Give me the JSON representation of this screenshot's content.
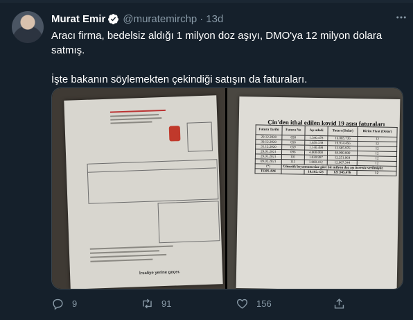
{
  "tweet": {
    "author_name": "Murat Emir",
    "handle": "@muratemirchp",
    "separator": "·",
    "time": "13d",
    "text_line1": "Aracı firma, bedelsiz aldığı 1 milyon doz aşıyı, DMO'ya 12 milyon dolara satmış.",
    "text_line2": "İşte bakanın söylemekten çekindiği satışın da faturaları."
  },
  "icons": {
    "verified": "verified-badge-icon",
    "more": "more-options-icon",
    "reply": "reply-icon",
    "retweet": "retweet-icon",
    "like": "like-icon",
    "share": "share-icon"
  },
  "actions": {
    "reply_count": "9",
    "retweet_count": "91",
    "like_count": "156"
  },
  "media": {
    "left_photo": {
      "company_header": "BERMEN İLAÇ SANAYİ VE TİCARET A.Ş.",
      "footer_text": "İrsaliye yerine geçer."
    },
    "right_photo": {
      "title": "Çin'den ithal edilen kovid 19 aşısı faturaları",
      "columns": [
        "Fatura Tarihi",
        "Fatura No",
        "Aşı adedi",
        "Tutarı (Dolar)",
        "Birim Fiyat (Dolar)"
      ],
      "rows": [
        [
          "29.12.2020",
          "658",
          "1.340.478",
          "16.085.736",
          "12"
        ],
        [
          "30.12.2020",
          "656",
          "1.659.338",
          "19.914.456",
          "12"
        ],
        [
          "31.12.2020",
          "659",
          "1.140.498",
          "13.685.976",
          "12"
        ],
        [
          "29.01.2021",
          "096",
          "4.000.000",
          "48.000.000",
          "12"
        ],
        [
          "29.01.2021",
          "101",
          "1.020.997",
          "12.251.964",
          "12"
        ],
        [
          "09.02.2021",
          "113",
          "1.000.412",
          "12.007.344",
          "12"
        ]
      ],
      "note_marker": "(*)",
      "note": "Gümrük beyannamesine göre bir milyon doz aşı ücretsiz verilmiştir.",
      "total_row": [
        "TOPLAM",
        "",
        "10.162.123",
        "121.945.476",
        "12"
      ]
    }
  }
}
